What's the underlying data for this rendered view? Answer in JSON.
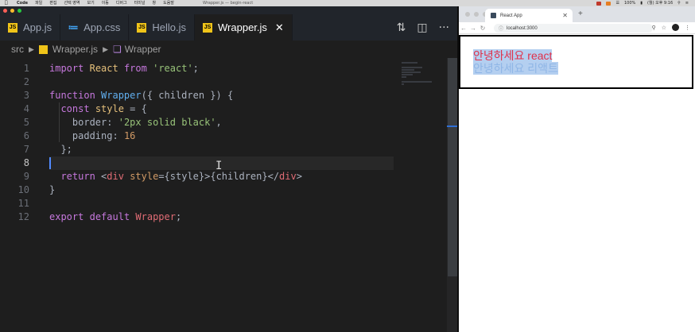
{
  "menubar": {
    "app_name": "Code",
    "items": [
      "파일",
      "편집",
      "선택 영역",
      "보기",
      "이동",
      "디버그",
      "터미널",
      "창",
      "도움말"
    ],
    "window_title": "Wrapper.js — begin-react",
    "battery": "100%",
    "clock": "(월) 오후 9:16"
  },
  "vscode": {
    "tabs": [
      {
        "label": "App.js",
        "type": "js"
      },
      {
        "label": "App.css",
        "type": "css"
      },
      {
        "label": "Hello.js",
        "type": "js"
      },
      {
        "label": "Wrapper.js",
        "type": "js",
        "active": true
      }
    ],
    "breadcrumb": {
      "folder": "src",
      "file": "Wrapper.js",
      "symbol": "Wrapper"
    },
    "line_numbers": [
      "1",
      "2",
      "3",
      "4",
      "5",
      "6",
      "7",
      "8",
      "9",
      "10",
      "11",
      "12"
    ],
    "current_line": 8
  },
  "browser": {
    "tab_title": "React App",
    "url": "localhost:3000",
    "page": {
      "line1": "안녕하세요 react",
      "line2": "안녕하세요 리액트"
    }
  },
  "colors": {
    "editor_bg": "#1e1e1e",
    "keyword": "#c678dd",
    "string": "#98c379",
    "function": "#61afef",
    "number": "#d19a66",
    "tag": "#e06c75",
    "page_text": "#e0304a"
  }
}
